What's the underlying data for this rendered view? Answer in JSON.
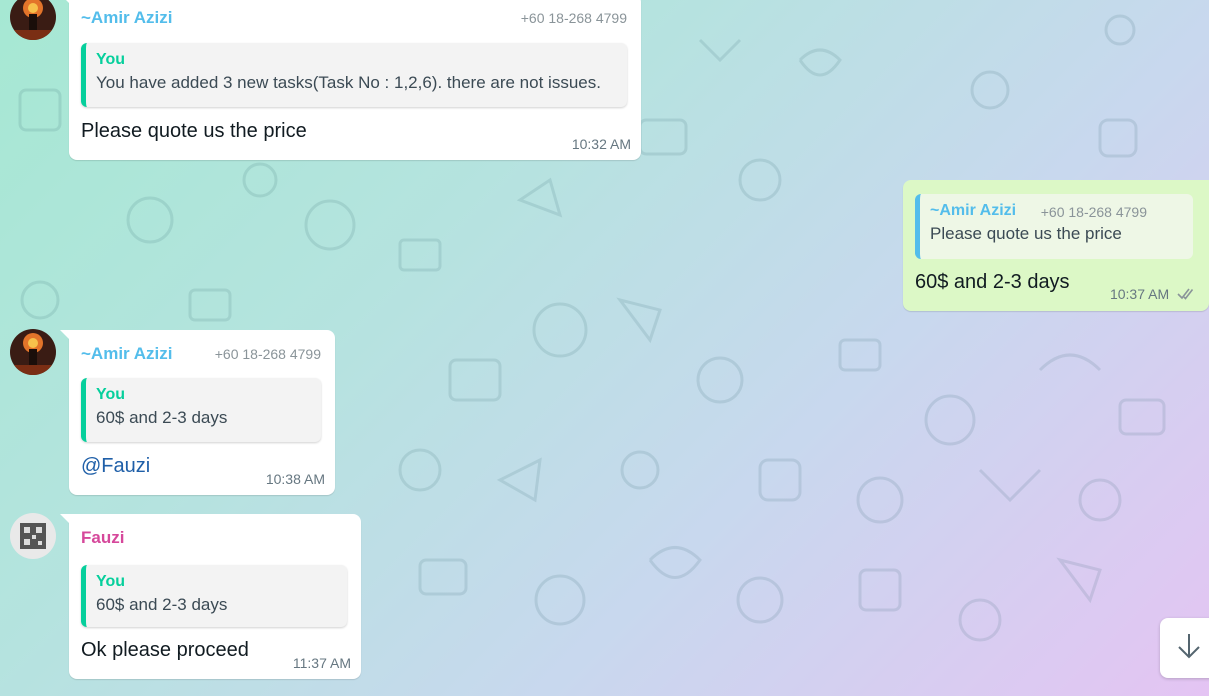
{
  "messages": [
    {
      "direction": "in",
      "sender": "~Amir Azizi",
      "phone": "+60 18-268 4799",
      "quote_author": "You",
      "quote_text": "You have added 3 new tasks(Task No : 1,2,6). there are not issues.",
      "text": "Please quote us the price",
      "time": "10:32 AM"
    },
    {
      "direction": "out",
      "quote_author": "~Amir Azizi",
      "quote_phone": "+60 18-268 4799",
      "quote_text": "Please quote us the price",
      "text": "60$ and 2-3 days",
      "time": "10:37 AM",
      "status_icon": "double-check-icon"
    },
    {
      "direction": "in",
      "sender": "~Amir Azizi",
      "phone": "+60 18-268 4799",
      "quote_author": "You",
      "quote_text": "60$ and 2-3 days",
      "text": "@Fauzi",
      "time": "10:38 AM"
    },
    {
      "direction": "in",
      "sender": "Fauzi",
      "quote_author": "You",
      "quote_text": "60$ and 2-3 days",
      "text": "Ok please proceed",
      "time": "11:37 AM"
    }
  ],
  "controls": {
    "scroll_to_bottom_icon": "arrow-down-icon"
  },
  "colors": {
    "sender_blue": "#53bdeb",
    "sender_pink": "#d6489b",
    "quote_bar_green": "#06cf9c",
    "outgoing_bubble": "#dcf8c6"
  }
}
